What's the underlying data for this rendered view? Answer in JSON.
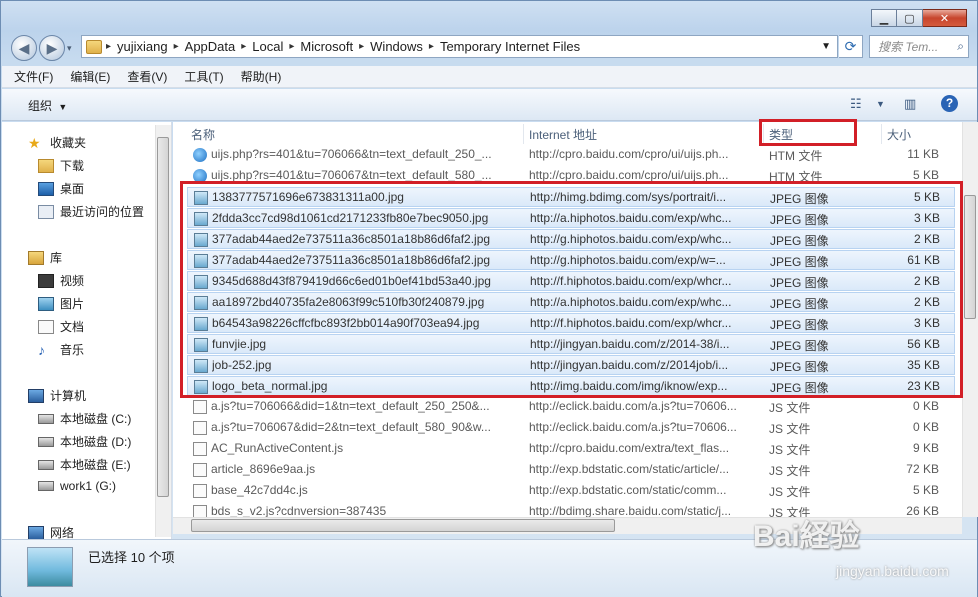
{
  "address": {
    "segments": [
      "yujixiang",
      "AppData",
      "Local",
      "Microsoft",
      "Windows",
      "Temporary Internet Files"
    ],
    "search_placeholder": "搜索 Tem..."
  },
  "menu": [
    "文件(F)",
    "编辑(E)",
    "查看(V)",
    "工具(T)",
    "帮助(H)"
  ],
  "toolbar": {
    "organize": "组织"
  },
  "nav": {
    "favorites": "收藏夹",
    "downloads": "下载",
    "desktop": "桌面",
    "recent": "最近访问的位置",
    "libraries": "库",
    "videos": "视频",
    "pictures": "图片",
    "documents": "文档",
    "music": "音乐",
    "computer": "计算机",
    "disk_c": "本地磁盘 (C:)",
    "disk_d": "本地磁盘 (D:)",
    "disk_e": "本地磁盘 (E:)",
    "work1": "work1 (G:)",
    "network": "网络"
  },
  "columns": {
    "name": "名称",
    "url": "Internet 地址",
    "type": "类型",
    "size": "大小"
  },
  "files": [
    {
      "name": "uijs.php?rs=401&tu=706066&tn=text_default_250_...",
      "url": "http://cpro.baidu.com/cpro/ui/uijs.ph...",
      "type": "HTM 文件",
      "size": "11 KB",
      "kind": "htm",
      "selected": false
    },
    {
      "name": "uijs.php?rs=401&tu=706067&tn=text_default_580_...",
      "url": "http://cpro.baidu.com/cpro/ui/uijs.ph...",
      "type": "HTM 文件",
      "size": "5 KB",
      "kind": "htm",
      "selected": false
    },
    {
      "name": "1383777571696e673831311a00.jpg",
      "url": "http://himg.bdimg.com/sys/portrait/i...",
      "type": "JPEG 图像",
      "size": "5 KB",
      "kind": "jpg",
      "selected": true
    },
    {
      "name": "2fdda3cc7cd98d1061cd2171233fb80e7bec9050.jpg",
      "url": "http://a.hiphotos.baidu.com/exp/whc...",
      "type": "JPEG 图像",
      "size": "3 KB",
      "kind": "jpg",
      "selected": true
    },
    {
      "name": "377adab44aed2e737511a36c8501a18b86d6faf2.jpg",
      "url": "http://g.hiphotos.baidu.com/exp/whc...",
      "type": "JPEG 图像",
      "size": "2 KB",
      "kind": "jpg",
      "selected": true
    },
    {
      "name": "377adab44aed2e737511a36c8501a18b86d6faf2.jpg",
      "url": "http://g.hiphotos.baidu.com/exp/w=...",
      "type": "JPEG 图像",
      "size": "61 KB",
      "kind": "jpg",
      "selected": true
    },
    {
      "name": "9345d688d43f879419d66c6ed01b0ef41bd53a40.jpg",
      "url": "http://f.hiphotos.baidu.com/exp/whcr...",
      "type": "JPEG 图像",
      "size": "2 KB",
      "kind": "jpg",
      "selected": true
    },
    {
      "name": "aa18972bd40735fa2e8063f99c510fb30f240879.jpg",
      "url": "http://a.hiphotos.baidu.com/exp/whc...",
      "type": "JPEG 图像",
      "size": "2 KB",
      "kind": "jpg",
      "selected": true
    },
    {
      "name": "b64543a98226cffcfbc893f2bb014a90f703ea94.jpg",
      "url": "http://f.hiphotos.baidu.com/exp/whcr...",
      "type": "JPEG 图像",
      "size": "3 KB",
      "kind": "jpg",
      "selected": true
    },
    {
      "name": "funvjie.jpg",
      "url": "http://jingyan.baidu.com/z/2014-38/i...",
      "type": "JPEG 图像",
      "size": "56 KB",
      "kind": "jpg",
      "selected": true
    },
    {
      "name": "job-252.jpg",
      "url": "http://jingyan.baidu.com/z/2014job/i...",
      "type": "JPEG 图像",
      "size": "35 KB",
      "kind": "jpg",
      "selected": true
    },
    {
      "name": "logo_beta_normal.jpg",
      "url": "http://img.baidu.com/img/iknow/exp...",
      "type": "JPEG 图像",
      "size": "23 KB",
      "kind": "jpg",
      "selected": true
    },
    {
      "name": "a.js?tu=706066&did=1&tn=text_default_250_250&...",
      "url": "http://eclick.baidu.com/a.js?tu=70606...",
      "type": "JS 文件",
      "size": "0 KB",
      "kind": "js",
      "selected": false
    },
    {
      "name": "a.js?tu=706067&did=2&tn=text_default_580_90&w...",
      "url": "http://eclick.baidu.com/a.js?tu=70606...",
      "type": "JS 文件",
      "size": "0 KB",
      "kind": "js",
      "selected": false
    },
    {
      "name": "AC_RunActiveContent.js",
      "url": "http://cpro.baidu.com/extra/text_flas...",
      "type": "JS 文件",
      "size": "9 KB",
      "kind": "js",
      "selected": false
    },
    {
      "name": "article_8696e9aa.js",
      "url": "http://exp.bdstatic.com/static/article/...",
      "type": "JS 文件",
      "size": "72 KB",
      "kind": "js",
      "selected": false
    },
    {
      "name": "base_42c7dd4c.js",
      "url": "http://exp.bdstatic.com/static/comm...",
      "type": "JS 文件",
      "size": "5 KB",
      "kind": "js",
      "selected": false
    },
    {
      "name": "bds_s_v2.js?cdnversion=387435",
      "url": "http://bdimg.share.baidu.com/static/j...",
      "type": "JS 文件",
      "size": "26 KB",
      "kind": "js",
      "selected": false
    }
  ],
  "status": "已选择 10 个项",
  "watermark": {
    "main": "Bai経验",
    "sub": "jingyan.baidu.com"
  }
}
